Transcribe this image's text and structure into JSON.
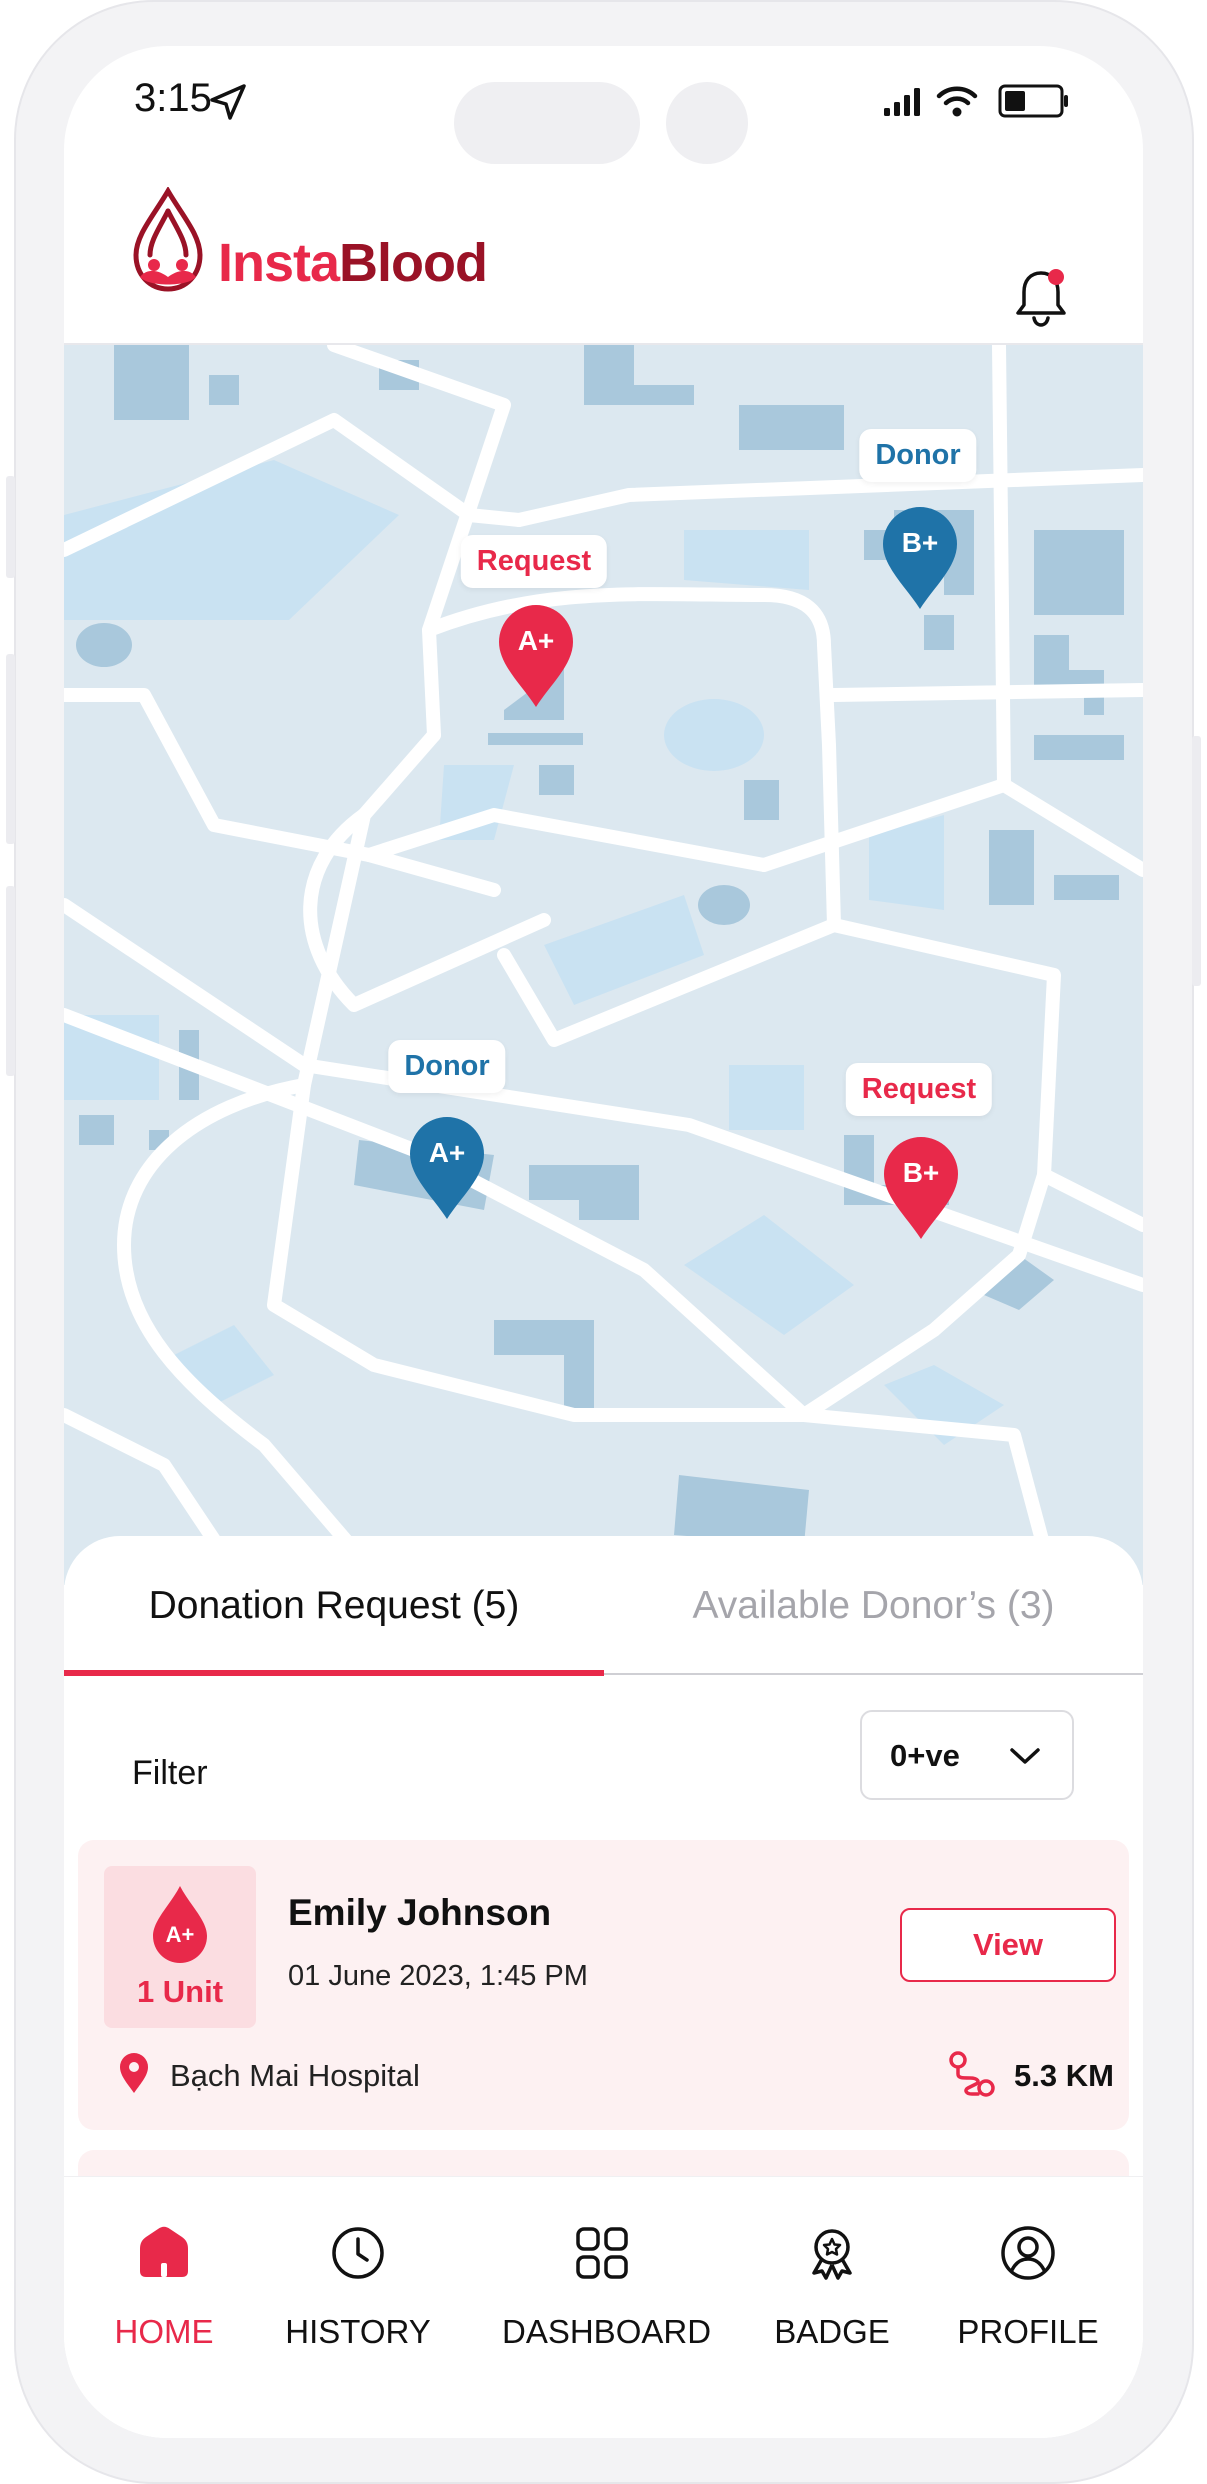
{
  "status_bar": {
    "time": "3:15"
  },
  "header": {
    "logo_part1": "Insta",
    "logo_part2": "Blood"
  },
  "map": {
    "markers": [
      {
        "kind": "Request",
        "blood_group": "A+",
        "color": "#e8294a"
      },
      {
        "kind": "Donor",
        "blood_group": "B+",
        "color": "#1f73a8"
      },
      {
        "kind": "Donor",
        "blood_group": "A+",
        "color": "#1f73a8"
      },
      {
        "kind": "Request",
        "blood_group": "B+",
        "color": "#e8294a"
      }
    ]
  },
  "tabs": [
    {
      "label": "Donation Request (5)",
      "active": true
    },
    {
      "label": "Available Donor’s (3)",
      "active": false
    }
  ],
  "filter": {
    "label": "Filter",
    "selected": "0+ve",
    "icon": "chevron-down-icon"
  },
  "requests": [
    {
      "blood_group": "A+",
      "units": "1 Unit",
      "name": "Emily Johnson",
      "datetime": "01 June 2023, 1:45 PM",
      "action": "View",
      "hospital": "Bạch Mai Hospital",
      "distance": "5.3 KM"
    }
  ],
  "bottom_nav": [
    {
      "label": "HOME",
      "icon": "home-icon",
      "active": true
    },
    {
      "label": "HISTORY",
      "icon": "clock-icon",
      "active": false
    },
    {
      "label": "DASHBOARD",
      "icon": "grid-icon",
      "active": false
    },
    {
      "label": "BADGE",
      "icon": "badge-icon",
      "active": false
    },
    {
      "label": "PROFILE",
      "icon": "user-icon",
      "active": false
    }
  ],
  "colors": {
    "accent": "#e8294a",
    "brand_dark": "#9a1226",
    "donor_blue": "#1f73a8",
    "map_background": "#dce8f0",
    "card_background": "#fdf1f2"
  }
}
